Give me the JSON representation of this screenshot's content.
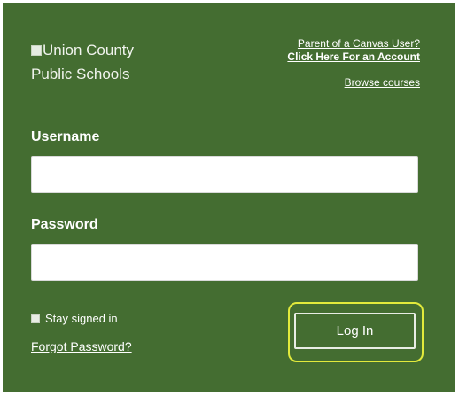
{
  "logo": {
    "alt_line1": "Union County",
    "alt_line2": "Public Schools"
  },
  "links": {
    "parent_text": "Parent of a Canvas User?",
    "account_text": "Click Here For an Account",
    "browse_text": "Browse courses"
  },
  "form": {
    "username_label": "Username",
    "username_value": "",
    "password_label": "Password",
    "password_value": "",
    "stay_signed_in_label": "Stay signed in",
    "stay_signed_in_checked": false,
    "forgot_password_text": "Forgot Password?",
    "login_button_label": "Log In"
  },
  "colors": {
    "panel_background": "#446d31",
    "focus_ring": "#e2ea3c",
    "text": "#ffffff"
  }
}
